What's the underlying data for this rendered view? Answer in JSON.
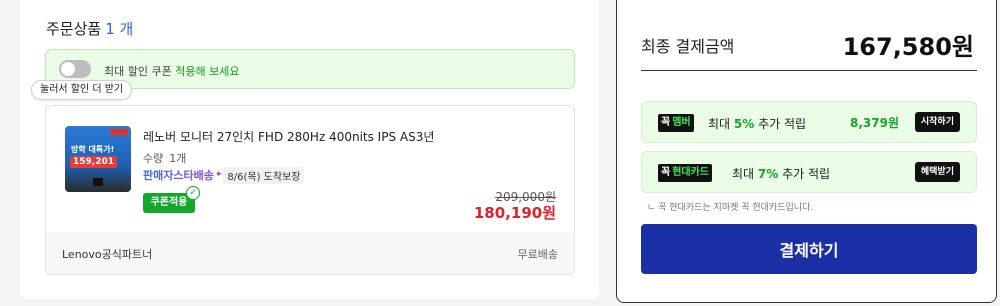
{
  "order": {
    "title": "주문상품",
    "count": "1 개",
    "coupon_toggle": {
      "text_prefix": "최대 할인 쿠폰",
      "text_accent": "적용해 보세요",
      "tooltip": "눌러서 할인 더 받기"
    },
    "item": {
      "thumbnail": {
        "promo": "방학 대특가!",
        "price": "159,201"
      },
      "name": "레노버 모니터 27인치 FHD 280Hz 400nits IPS AS3년",
      "qty_label": "수량",
      "qty_value": "1개",
      "delivery_badge": "판매자스타배송",
      "delivery_date": "8/6(목) 도착보장",
      "coupon_chip": "쿠폰적용",
      "original_price": "209,000원",
      "sale_price": "180,190원",
      "seller": "Lenovo공식파트너",
      "shipping": "무료배송"
    }
  },
  "summary": {
    "label": "최종 결제금액",
    "total": "167,580원",
    "benefits": [
      {
        "logo_k": "꼭",
        "logo_word": "멤버",
        "text_prefix": "최대",
        "percent": "5%",
        "text_suffix": "추가 적립",
        "reward": "8,379원",
        "button": "시작하기"
      },
      {
        "logo_k": "꼭",
        "logo_word": "현대카드",
        "text_prefix": "최대",
        "percent": "7%",
        "text_suffix": "추가 적립",
        "button": "혜택받기"
      }
    ],
    "notice": "ㄴ 꼭 현대카드는 지마켓 꼭 현대카드입니다.",
    "pay_button": "결제하기"
  },
  "colors": {
    "accent_blue": "#2a64e8",
    "green": "#12a82a",
    "price_red": "#e0202a",
    "pay_navy": "#1b2fa6"
  }
}
